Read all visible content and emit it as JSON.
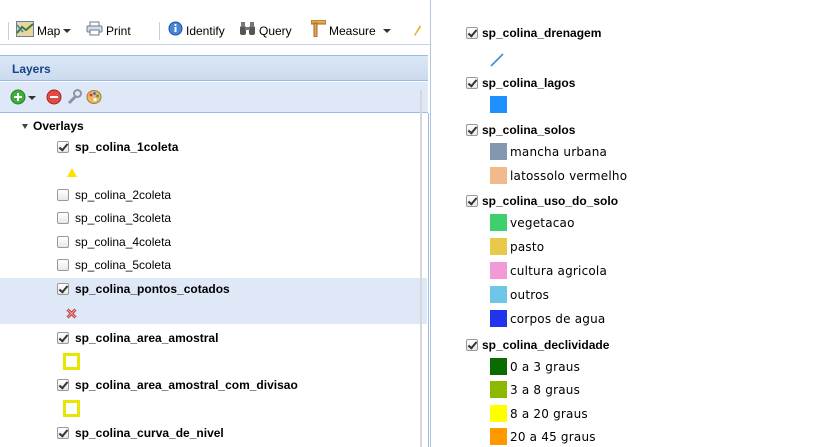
{
  "toolbar": {
    "map_label": "Map",
    "print_label": "Print",
    "identify_label": "Identify",
    "query_label": "Query",
    "measure_label": "Measure"
  },
  "layers_panel": {
    "title": "Layers",
    "root_label": "Overlays",
    "layers": [
      {
        "label": "sp_colina_1coleta",
        "checked": true,
        "symbol": "yellow-triangle"
      },
      {
        "label": "sp_colina_2coleta",
        "checked": false
      },
      {
        "label": "sp_colina_3coleta",
        "checked": false
      },
      {
        "label": "sp_colina_4coleta",
        "checked": false
      },
      {
        "label": "sp_colina_5coleta",
        "checked": false
      },
      {
        "label": "sp_colina_pontos_cotados",
        "checked": true,
        "selected": true,
        "symbol": "red-cross"
      },
      {
        "label": "sp_colina_area_amostral",
        "checked": true,
        "symbol": "yellow-square-outline"
      },
      {
        "label": "sp_colina_area_amostral_com_divisao",
        "checked": true,
        "symbol": "yellow-square-outline"
      },
      {
        "label": "sp_colina_curva_de_nivel",
        "checked": true
      }
    ]
  },
  "legend": {
    "groups": [
      {
        "label": "sp_colina_drenagem",
        "items": [
          {
            "label": "",
            "color": "#4a90d9",
            "kind": "line"
          }
        ]
      },
      {
        "label": "sp_colina_lagos",
        "items": [
          {
            "label": "",
            "color": "#1e90ff"
          }
        ]
      },
      {
        "label": "sp_colina_solos",
        "items": [
          {
            "label": "mancha urbana",
            "color": "#8497b0"
          },
          {
            "label": "latossolo vermelho",
            "color": "#f2b98a"
          }
        ]
      },
      {
        "label": "sp_colina_uso_do_solo",
        "items": [
          {
            "label": "vegetacao",
            "color": "#3ecf6e"
          },
          {
            "label": "pasto",
            "color": "#e8c94a"
          },
          {
            "label": "cultura agricola",
            "color": "#f29ad6"
          },
          {
            "label": "outros",
            "color": "#6ec6e6"
          },
          {
            "label": "corpos de agua",
            "color": "#2233ee"
          }
        ]
      },
      {
        "label": "sp_colina_declividade",
        "items": [
          {
            "label": "0 a 3 graus",
            "color": "#0a6b00"
          },
          {
            "label": "3 a 8 graus",
            "color": "#8cb800"
          },
          {
            "label": "8 a 20 graus",
            "color": "#ffff00"
          },
          {
            "label": "20 a 45 graus",
            "color": "#ff9900"
          }
        ]
      }
    ]
  }
}
